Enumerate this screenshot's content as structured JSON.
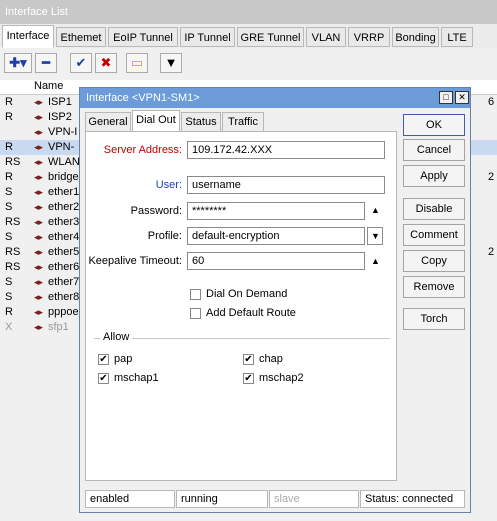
{
  "background": {
    "title": "Interface List",
    "tabs": [
      "Interface",
      "Ethemet",
      "EoIP Tunnel",
      "IP Tunnel",
      "GRE Tunnel",
      "VLAN",
      "VRRP",
      "Bonding",
      "LTE"
    ],
    "table_header": "Name",
    "rows": [
      {
        "flag": "R",
        "name": "ISP1",
        "extra": "6"
      },
      {
        "flag": "R",
        "name": "ISP2",
        "extra": ""
      },
      {
        "flag": "",
        "name": "VPN-I",
        "extra": ""
      },
      {
        "flag": "R",
        "name": "VPN-",
        "extra": ""
      },
      {
        "flag": "RS",
        "name": "WLAN",
        "extra": ""
      },
      {
        "flag": "R",
        "name": "bridge",
        "extra": "2"
      },
      {
        "flag": "S",
        "name": "ether1",
        "extra": ""
      },
      {
        "flag": "S",
        "name": "ether2",
        "extra": ""
      },
      {
        "flag": "RS",
        "name": "ether3",
        "extra": ""
      },
      {
        "flag": "S",
        "name": "ether4",
        "extra": ""
      },
      {
        "flag": "RS",
        "name": "ether5",
        "extra": "2"
      },
      {
        "flag": "RS",
        "name": "ether6",
        "extra": ""
      },
      {
        "flag": "S",
        "name": "ether7",
        "extra": ""
      },
      {
        "flag": "S",
        "name": "ether8",
        "extra": ""
      },
      {
        "flag": "R",
        "name": "pppoe",
        "extra": ""
      },
      {
        "flag": "X",
        "name": "sfp1",
        "extra": ""
      }
    ]
  },
  "dialog": {
    "title": "Interface <VPN1-SM1>",
    "tabs": [
      "General",
      "Dial Out",
      "Status",
      "Traffic"
    ],
    "fields": {
      "server_address_label": "Server Address:",
      "server_address": "109.172.42.XXX",
      "user_label": "User:",
      "user": "username",
      "password_label": "Password:",
      "password": "********",
      "profile_label": "Profile:",
      "profile": "default-encryption",
      "keepalive_label": "Keepalive Timeout:",
      "keepalive": "60"
    },
    "options": {
      "dial_on_demand": "Dial On Demand",
      "add_default_route": "Add Default Route"
    },
    "allow": {
      "label": "Allow",
      "pap": "pap",
      "chap": "chap",
      "mschap1": "mschap1",
      "mschap2": "mschap2"
    },
    "buttons": [
      "OK",
      "Cancel",
      "Apply",
      "Disable",
      "Comment",
      "Copy",
      "Remove",
      "Torch"
    ],
    "status": {
      "state": "enabled",
      "running": "running",
      "slave": "slave",
      "connection": "Status: connected"
    }
  }
}
